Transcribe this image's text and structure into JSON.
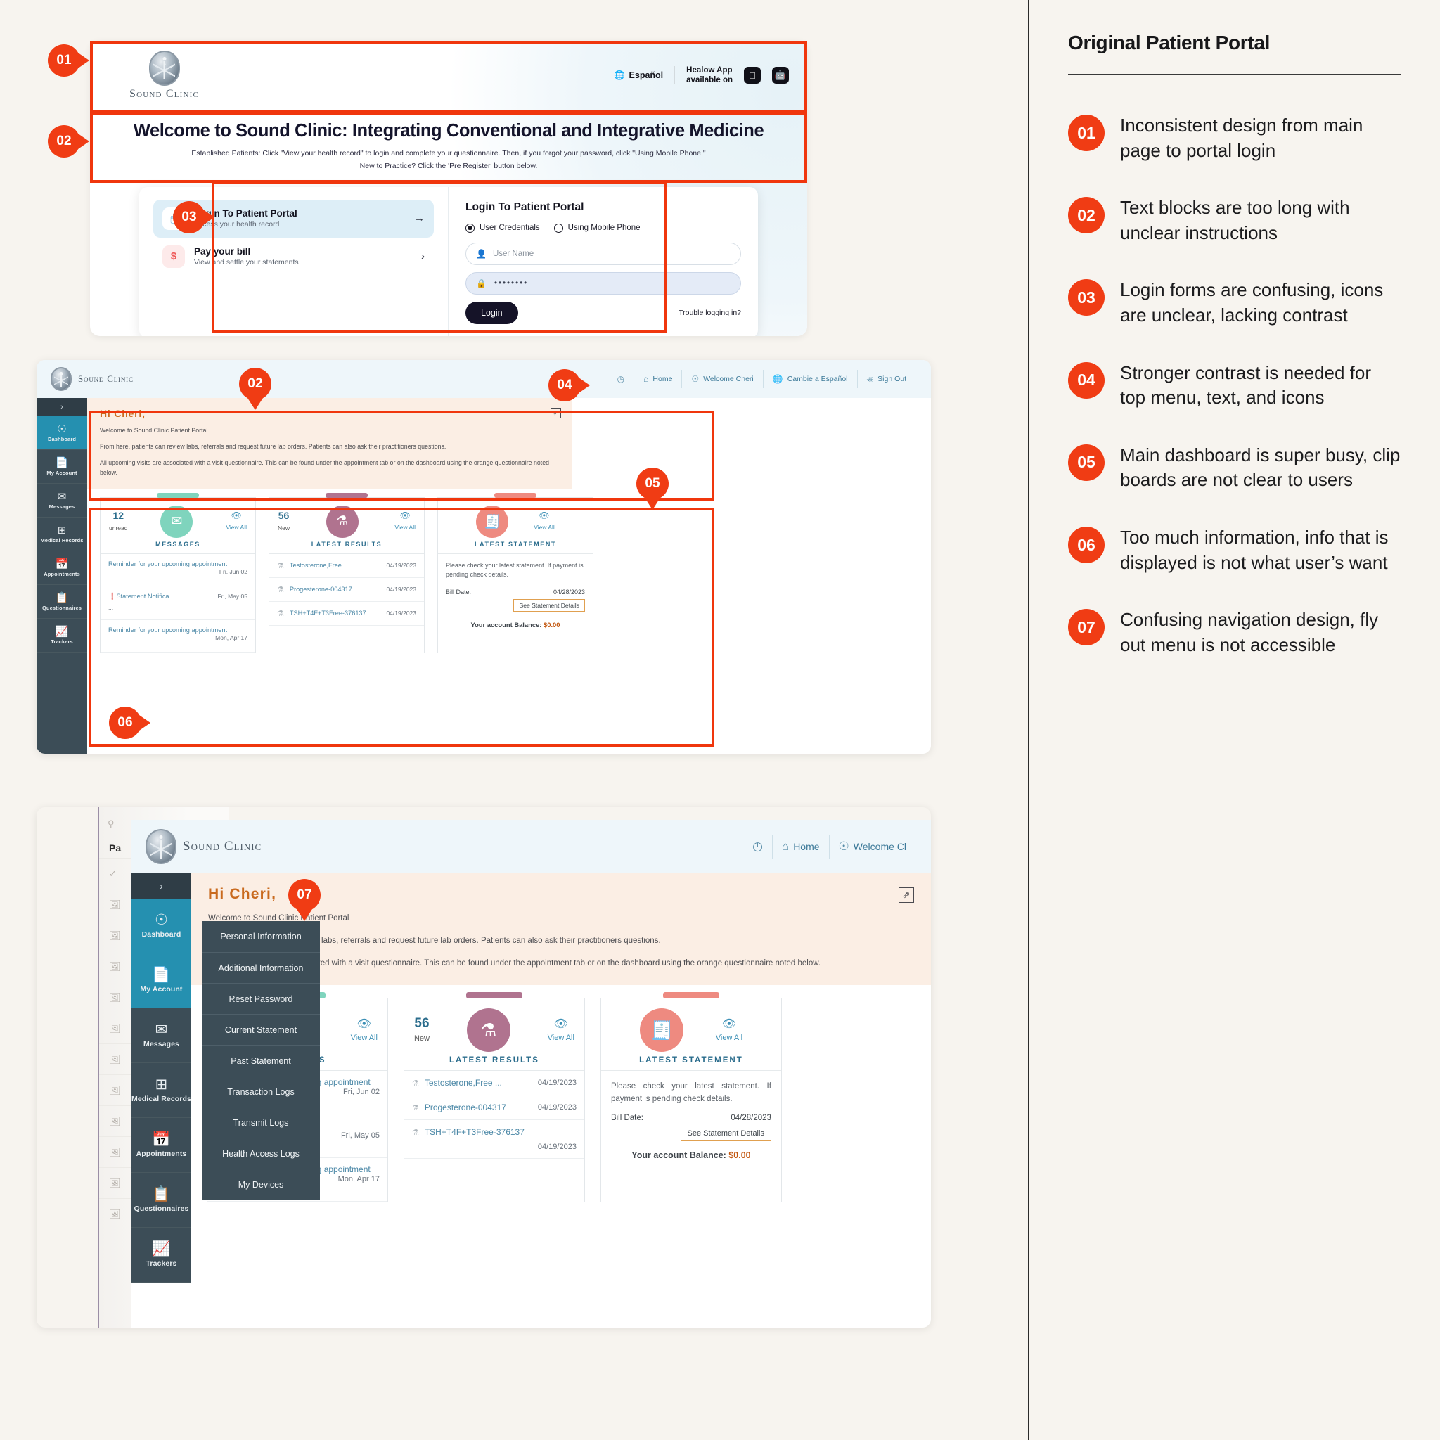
{
  "annotations_panel": {
    "title": "Original Patient Portal",
    "items": [
      {
        "num": "01",
        "text": "Inconsistent design from main page to portal login"
      },
      {
        "num": "02",
        "text": "Text blocks are too long with unclear instructions"
      },
      {
        "num": "03",
        "text": "Login forms are confusing, icons are unclear, lacking contrast"
      },
      {
        "num": "04",
        "text": "Stronger contrast is needed for top menu, text, and icons"
      },
      {
        "num": "05",
        "text": "Main dashboard is super busy, clip boards are not clear to users"
      },
      {
        "num": "06",
        "text": "Too much information, info that is displayed is not what user’s want"
      },
      {
        "num": "07",
        "text": "Confusing navigation design, fly out menu is not accessible"
      }
    ]
  },
  "pins": {
    "p01": "01",
    "p02": "02",
    "p03": "03",
    "p02b": "02",
    "p04": "04",
    "p05": "05",
    "p06": "06",
    "p07": "07"
  },
  "mock_public": {
    "brand": "Sound Clinic",
    "header": {
      "language_label": "Español",
      "healow_label": "Healow App\navailable on",
      "apple_icon": "apple-icon",
      "android_icon": "android-icon",
      "globe_icon": "globe-icon"
    },
    "banner": {
      "heading": "Welcome to Sound Clinic: Integrating Conventional and Integrative Medicine",
      "line1": "Established Patients: Click \"View your health record\" to login and complete your questionnaire. Then, if you forgot your password, click \"Using Mobile Phone.\"",
      "line2": "New to Practice? Click the 'Pre Register' button below."
    },
    "options": [
      {
        "title": "Login To Patient Portal",
        "subtitle": "Access your health record",
        "icon": "id-card-icon",
        "arrow": "→"
      },
      {
        "title": "Pay your bill",
        "subtitle": "View and settle your statements",
        "icon": "dollar-icon",
        "arrow": "›"
      }
    ],
    "login_form": {
      "heading": "Login To Patient Portal",
      "radio_credentials": "User Credentials",
      "radio_mobile": "Using Mobile Phone",
      "username_placeholder": "User Name",
      "password_value": "••••••••",
      "submit_label": "Login",
      "trouble_label": "Trouble logging in?"
    }
  },
  "mock_portal": {
    "brand": "Sound Clinic",
    "topnav": [
      {
        "label": "",
        "icon": "history-icon"
      },
      {
        "label": "Home",
        "icon": "home-icon"
      },
      {
        "label": "Welcome Cheri",
        "icon": "user-icon"
      },
      {
        "label": "Cambie a Español",
        "icon": "globe-icon"
      },
      {
        "label": "Sign Out",
        "icon": "power-icon"
      }
    ],
    "sidebar": {
      "toggle": "›",
      "items": [
        {
          "label": "Dashboard",
          "icon": "dashboard-icon",
          "active": true
        },
        {
          "label": "My Account",
          "icon": "document-icon",
          "active": false
        },
        {
          "label": "Messages",
          "icon": "envelope-icon",
          "active": false
        },
        {
          "label": "Medical Records",
          "icon": "records-icon",
          "active": false
        },
        {
          "label": "Appointments",
          "icon": "calendar-icon",
          "active": false
        },
        {
          "label": "Questionnaires",
          "icon": "clipboard-icon",
          "active": false
        },
        {
          "label": "Trackers",
          "icon": "chart-icon",
          "active": false
        }
      ]
    },
    "welcome": {
      "greeting": "Hi Cheri,",
      "subtitle": "Welcome to Sound Clinic Patient Portal",
      "para1": "From here, patients can review labs, referrals and request future lab orders. Patients can also ask their practitioners questions.",
      "para2": "All upcoming visits are associated with a visit questionnaire. This can be found under the appointment tab or on the dashboard using the orange questionnaire noted below.",
      "expand_icon": "expand-icon"
    },
    "cards": {
      "messages": {
        "count": "12",
        "count_label": "unread",
        "title": "MESSAGES",
        "view_all": "View All",
        "icon": "envelope-icon",
        "rows": [
          {
            "text": "Reminder for your upcoming appointment",
            "date": "Fri, Jun 02",
            "alert": false
          },
          {
            "text": "Statement Notifica...",
            "date": "Fri, May 05",
            "alert": true,
            "extra": "..."
          },
          {
            "text": "Reminder for your upcoming appointment",
            "date": "Mon, Apr 17",
            "alert": false
          }
        ]
      },
      "results": {
        "count": "56",
        "count_label": "New",
        "title": "LATEST RESULTS",
        "view_all": "View All",
        "icon": "flask-icon",
        "rows": [
          {
            "name": "Testosterone,Free ...",
            "date": "04/19/2023"
          },
          {
            "name": "Progesterone-004317",
            "date": "04/19/2023"
          },
          {
            "name": "TSH+T4F+T3Free-376137",
            "date": "04/19/2023"
          }
        ]
      },
      "statement": {
        "title": "LATEST STATEMENT",
        "view_all": "View All",
        "icon": "receipt-icon",
        "note": "Please check your latest statement. If payment is pending check details.",
        "bill_date_label": "Bill Date:",
        "bill_date_value": "04/28/2023",
        "details_button": "See Statement Details",
        "balance_label": "Your account Balance:",
        "balance_value": "$0.00"
      }
    }
  },
  "mock_flyout": {
    "ghost_window": {
      "search_icon": "search-icon",
      "title": "Pa",
      "check": "✓",
      "row_icon": "image-icon"
    },
    "flyout_menu": [
      "Personal Information",
      "Additional Information",
      "Reset Password",
      "Current Statement",
      "Past Statement",
      "Transaction Logs",
      "Transmit Logs",
      "Health Access Logs",
      "My Devices"
    ],
    "topnav": [
      {
        "label": "",
        "icon": "history-icon"
      },
      {
        "label": "Home",
        "icon": "home-icon"
      },
      {
        "label": "Welcome Cl",
        "icon": "user-icon"
      }
    ]
  },
  "colors": {
    "accent_red": "#f03c14",
    "portal_teal": "#2590b0",
    "sidebar": "#3c4d57",
    "welcome_bg": "#fbeee4",
    "greeting": "#c96a1e",
    "messages_circle": "#7fd4bd",
    "results_circle": "#b0738f",
    "statement_circle": "#ee8a80",
    "balance": "#c2560e"
  }
}
